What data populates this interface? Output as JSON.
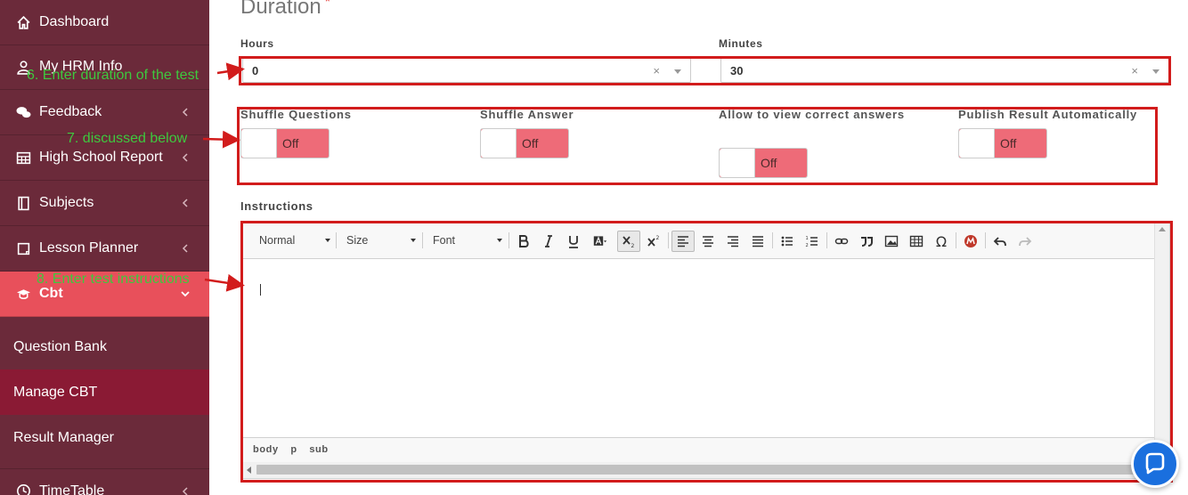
{
  "sidebar": {
    "items": [
      {
        "label": "Dashboard",
        "icon": "home-icon"
      },
      {
        "label": "My HRM Info",
        "icon": "user-icon"
      },
      {
        "label": "Feedback",
        "icon": "comments-icon"
      },
      {
        "label": "High School Report",
        "icon": "table-icon"
      },
      {
        "label": "Subjects",
        "icon": "book-icon"
      },
      {
        "label": "Lesson Planner",
        "icon": "note-icon"
      },
      {
        "label": "Cbt",
        "icon": "graduation-cap-icon"
      },
      {
        "label": "TimeTable",
        "icon": "clock-icon"
      }
    ],
    "sub_items": [
      {
        "label": "Question Bank"
      },
      {
        "label": "Manage CBT"
      },
      {
        "label": "Result Manager"
      }
    ]
  },
  "main": {
    "section_title": "Duration",
    "required_mark": "*",
    "hours": {
      "label": "Hours",
      "value": "0",
      "clear": "×"
    },
    "minutes": {
      "label": "Minutes",
      "value": "30",
      "clear": "×"
    },
    "toggles": [
      {
        "label": "Shuffle Questions",
        "state": "Off"
      },
      {
        "label": "Shuffle Answer",
        "state": "Off"
      },
      {
        "label": "Allow to view correct answers",
        "state": "Off"
      },
      {
        "label": "Publish Result Automatically",
        "state": "Off"
      }
    ],
    "instructions_label": "Instructions",
    "editor": {
      "format": "Normal",
      "size": "Size",
      "font": "Font",
      "path": [
        "body",
        "p",
        "sub"
      ]
    }
  },
  "annotations": [
    {
      "text": "6. Enter duration of the test"
    },
    {
      "text": "7. discussed below"
    },
    {
      "text": "8. Enter test instructions"
    }
  ],
  "colors": {
    "sidebar": "#6b2a3a",
    "active_nav": "#e8505b",
    "selected_sub": "#8a1a34",
    "toggle_off": "#ee6b78",
    "annotation_box": "#d21c1c",
    "annotation_text": "#3ec83e",
    "chat": "#1a6fde"
  }
}
